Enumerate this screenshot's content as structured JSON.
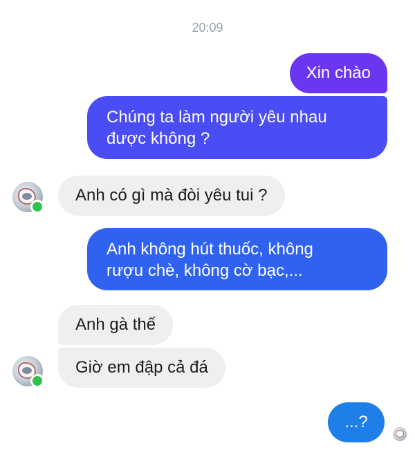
{
  "chat": {
    "timestamp": "20:09",
    "messages": [
      {
        "direction": "outgoing",
        "text": "Xin chào"
      },
      {
        "direction": "outgoing",
        "text": "Chúng ta làm người yêu nhau\nđược không ?"
      },
      {
        "direction": "incoming",
        "text": "Anh có gì mà đòi yêu tui ?"
      },
      {
        "direction": "outgoing",
        "text": "Anh không hút thuốc, không\nrượu chè, không cờ bạc,..."
      },
      {
        "direction": "incoming",
        "text": "Anh gà thế"
      },
      {
        "direction": "incoming",
        "text": "Giờ em đập cả đá"
      },
      {
        "direction": "outgoing",
        "text": "...?"
      }
    ],
    "contact_status": "online"
  },
  "colors": {
    "outgoing_top": "#6b36ef",
    "outgoing_bottom": "#1f7fe8",
    "incoming": "#efefef",
    "online": "#31c24a",
    "timestamp": "#9aa0a6"
  },
  "icons": {
    "avatar": "contact-avatar-icon",
    "online": "online-status-icon",
    "seen": "seen-receipt-avatar-icon"
  }
}
